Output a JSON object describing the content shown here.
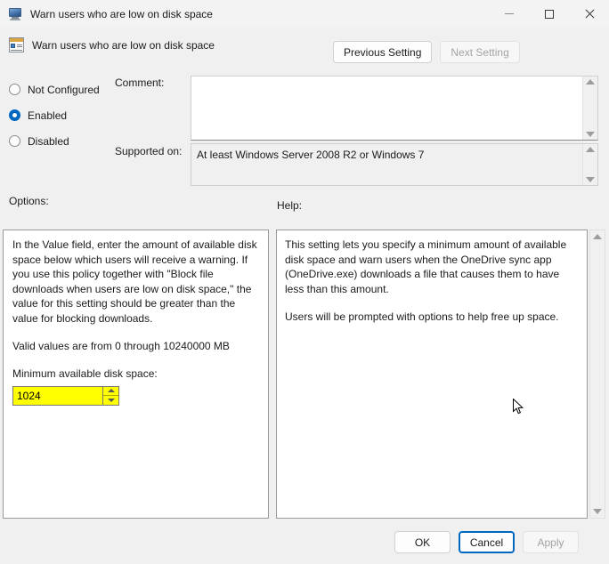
{
  "window": {
    "title": "Warn users who are low on disk space",
    "icon": "monitor-icon",
    "controls": {
      "minimize": "minimize-icon",
      "maximize": "maximize-icon",
      "close": "close-icon"
    }
  },
  "header": {
    "icon": "policy-setting-icon",
    "setting_name": "Warn users who are low on disk space",
    "previous_button": "Previous Setting",
    "next_button": "Next Setting"
  },
  "state": {
    "options": [
      {
        "label": "Not Configured",
        "selected": false
      },
      {
        "label": "Enabled",
        "selected": true
      },
      {
        "label": "Disabled",
        "selected": false
      }
    ]
  },
  "comment": {
    "label": "Comment:",
    "value": ""
  },
  "supported": {
    "label": "Supported on:",
    "value": "At least Windows Server 2008 R2 or Windows 7"
  },
  "options_panel": {
    "label": "Options:",
    "paragraph1": "In the Value field, enter the amount of available disk space below which users will receive a warning. If you use this policy together with \"Block file downloads when users are low on disk space,\" the value for this setting should be greater than the value for blocking downloads.",
    "paragraph2": "Valid values are from 0 through 10240000 MB",
    "field_label": "Minimum available disk space:",
    "field_value": "1024",
    "field_highlight_color": "#ffff00",
    "spinner_up": "spinner-up-icon",
    "spinner_down": "spinner-down-icon"
  },
  "help_panel": {
    "label": "Help:",
    "paragraph1": "This setting lets you specify a minimum amount of available disk space and warn users when the OneDrive sync app (OneDrive.exe) downloads a file that causes them to have less than this amount.",
    "paragraph2": "Users will be prompted with options to help free up space."
  },
  "footer": {
    "ok": "OK",
    "cancel": "Cancel",
    "apply": "Apply"
  },
  "colors": {
    "accent": "#0067c0",
    "window_background": "#f0f0f0",
    "field_background": "#ffffff",
    "highlight": "#ffff00",
    "disabled_text": "#a3a3a3"
  }
}
